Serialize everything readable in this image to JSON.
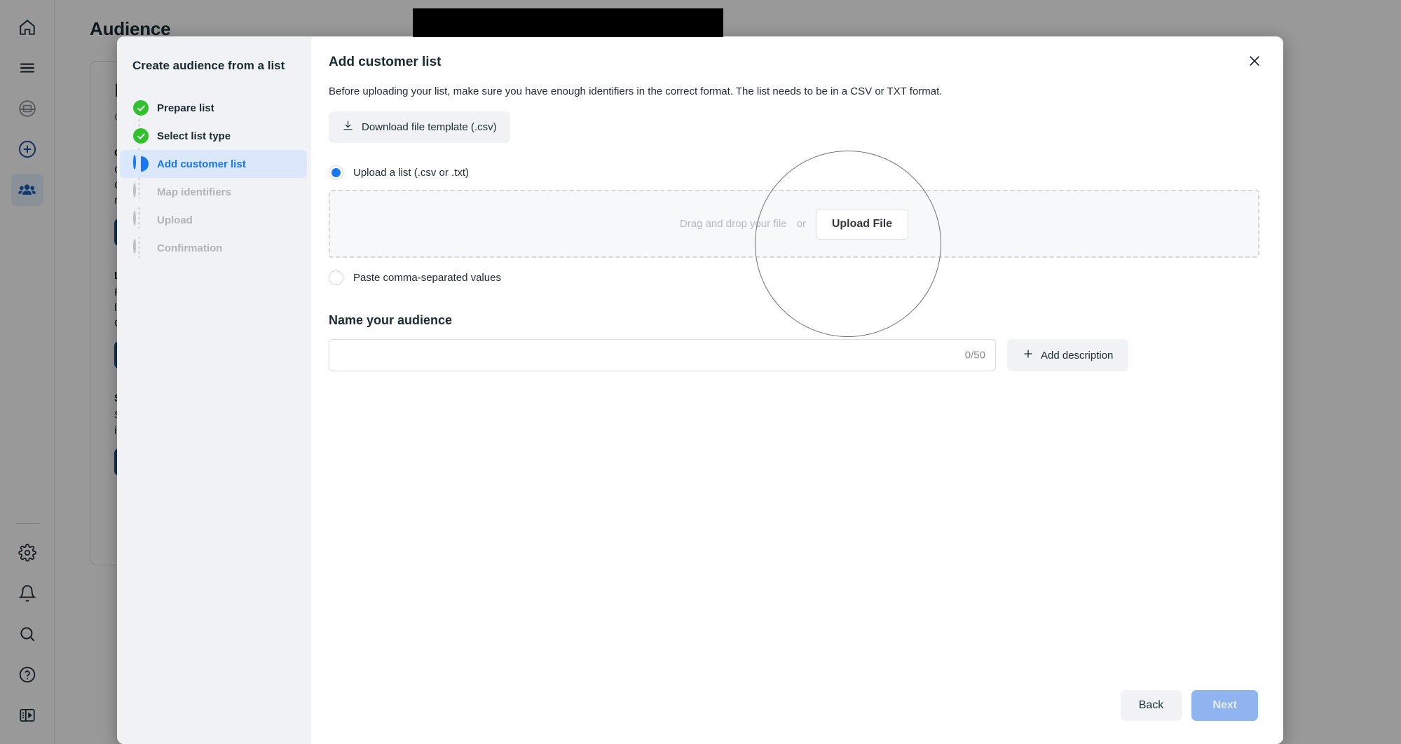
{
  "left_nav": {
    "top_items": [
      {
        "name": "home-icon",
        "label": "Home"
      },
      {
        "name": "menu-icon",
        "label": "Menu"
      },
      {
        "name": "business-icon",
        "label": "Business"
      },
      {
        "name": "create-icon",
        "label": "Create"
      },
      {
        "name": "audience-icon",
        "label": "Audience"
      }
    ],
    "bottom_items": [
      {
        "name": "settings-icon",
        "label": "Settings"
      },
      {
        "name": "notifications-icon",
        "label": "Notifications"
      },
      {
        "name": "search-icon",
        "label": "Search"
      },
      {
        "name": "help-icon",
        "label": "Help"
      },
      {
        "name": "expand-panel-icon",
        "label": "Expand panel"
      }
    ]
  },
  "background_page": {
    "title": "Audience",
    "card": {
      "heading": "Re",
      "subtext": "Cre",
      "blocks": [
        {
          "title": "Cus",
          "lines": [
            "Co",
            "Cus",
            "mo"
          ],
          "button": "C"
        },
        {
          "title": "Loo",
          "lines": [
            "Rea",
            "loo",
            "Cus"
          ],
          "button": "C"
        },
        {
          "title": "Sav",
          "lines": [
            "Sav",
            "inte"
          ],
          "button": "C"
        }
      ]
    }
  },
  "modal": {
    "sidebar": {
      "title": "Create audience from a list",
      "steps": [
        {
          "label": "Prepare list",
          "state": "done"
        },
        {
          "label": "Select list type",
          "state": "done"
        },
        {
          "label": "Add customer list",
          "state": "current"
        },
        {
          "label": "Map identifiers",
          "state": "todo"
        },
        {
          "label": "Upload",
          "state": "todo"
        },
        {
          "label": "Confirmation",
          "state": "todo"
        }
      ]
    },
    "heading": "Add customer list",
    "description": "Before uploading your list, make sure you have enough identifiers in the correct format. The list needs to be in a CSV or TXT format.",
    "download_template_label": "Download file template (.csv)",
    "options": [
      {
        "label": "Upload a list (.csv or .txt)",
        "selected": true
      },
      {
        "label": "Paste comma-separated values",
        "selected": false
      }
    ],
    "dropzone": {
      "text": "Drag and drop your file",
      "or": "or",
      "button_label": "Upload File"
    },
    "name_section": {
      "heading": "Name your audience",
      "input_value": "",
      "input_placeholder": "",
      "counter": "0/50",
      "add_description_label": "Add description"
    },
    "footer": {
      "back_label": "Back",
      "next_label": "Next"
    },
    "close_label": "Close"
  },
  "colors": {
    "accent_blue": "#1877f2",
    "done_green": "#31c12f",
    "disabled_next": "#8fb4f0",
    "annotation_stroke": "#6e6e6e"
  }
}
